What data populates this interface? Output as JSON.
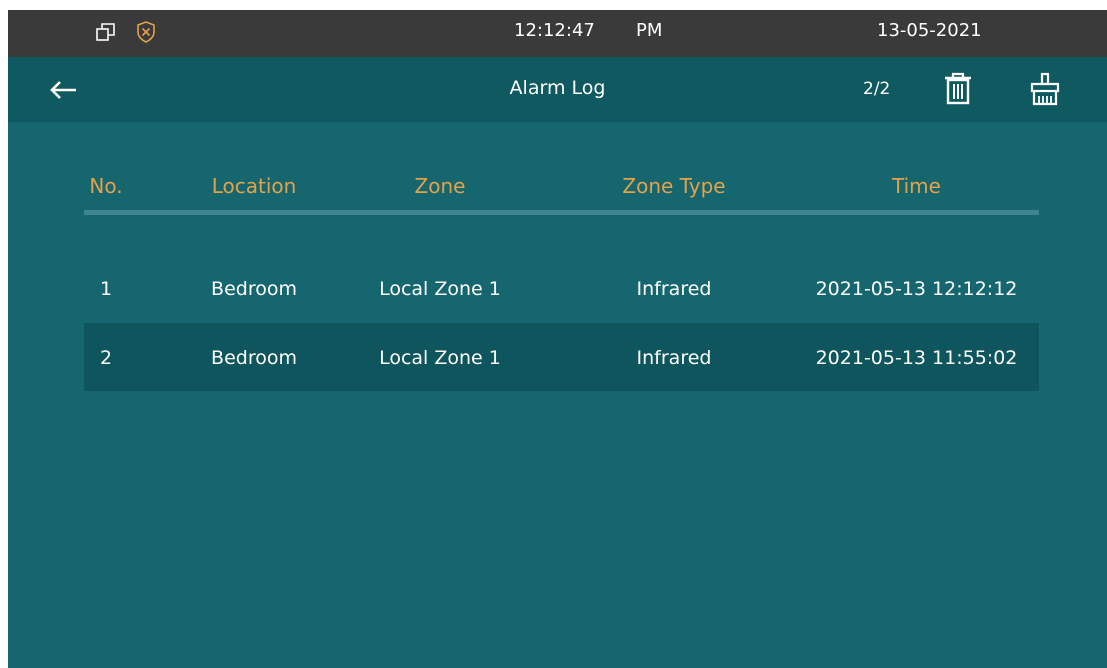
{
  "status_bar": {
    "time": "12:12:47",
    "meridiem": "PM",
    "date": "13-05-2021",
    "icons": [
      "windows-icon",
      "shield-alarm-icon"
    ]
  },
  "header": {
    "title": "Alarm Log",
    "page_indicator": "2/2",
    "icons": [
      "back-arrow-icon",
      "trash-icon",
      "clear-all-icon"
    ]
  },
  "table": {
    "columns": [
      "No.",
      "Location",
      "Zone",
      "Zone Type",
      "Time"
    ],
    "rows": [
      {
        "no": "1",
        "location": "Bedroom",
        "zone": "Local Zone 1",
        "zone_type": "Infrared",
        "time": "2021-05-13 12:12:12"
      },
      {
        "no": "2",
        "location": "Bedroom",
        "zone": "Local Zone 1",
        "zone_type": "Infrared",
        "time": "2021-05-13 11:55:02"
      }
    ]
  },
  "colors": {
    "background": "#15666f",
    "header": "#0f5960",
    "status_bar": "#3a3a3a",
    "column_header_text": "#e2a24a",
    "selected_row": "#0f555d"
  }
}
